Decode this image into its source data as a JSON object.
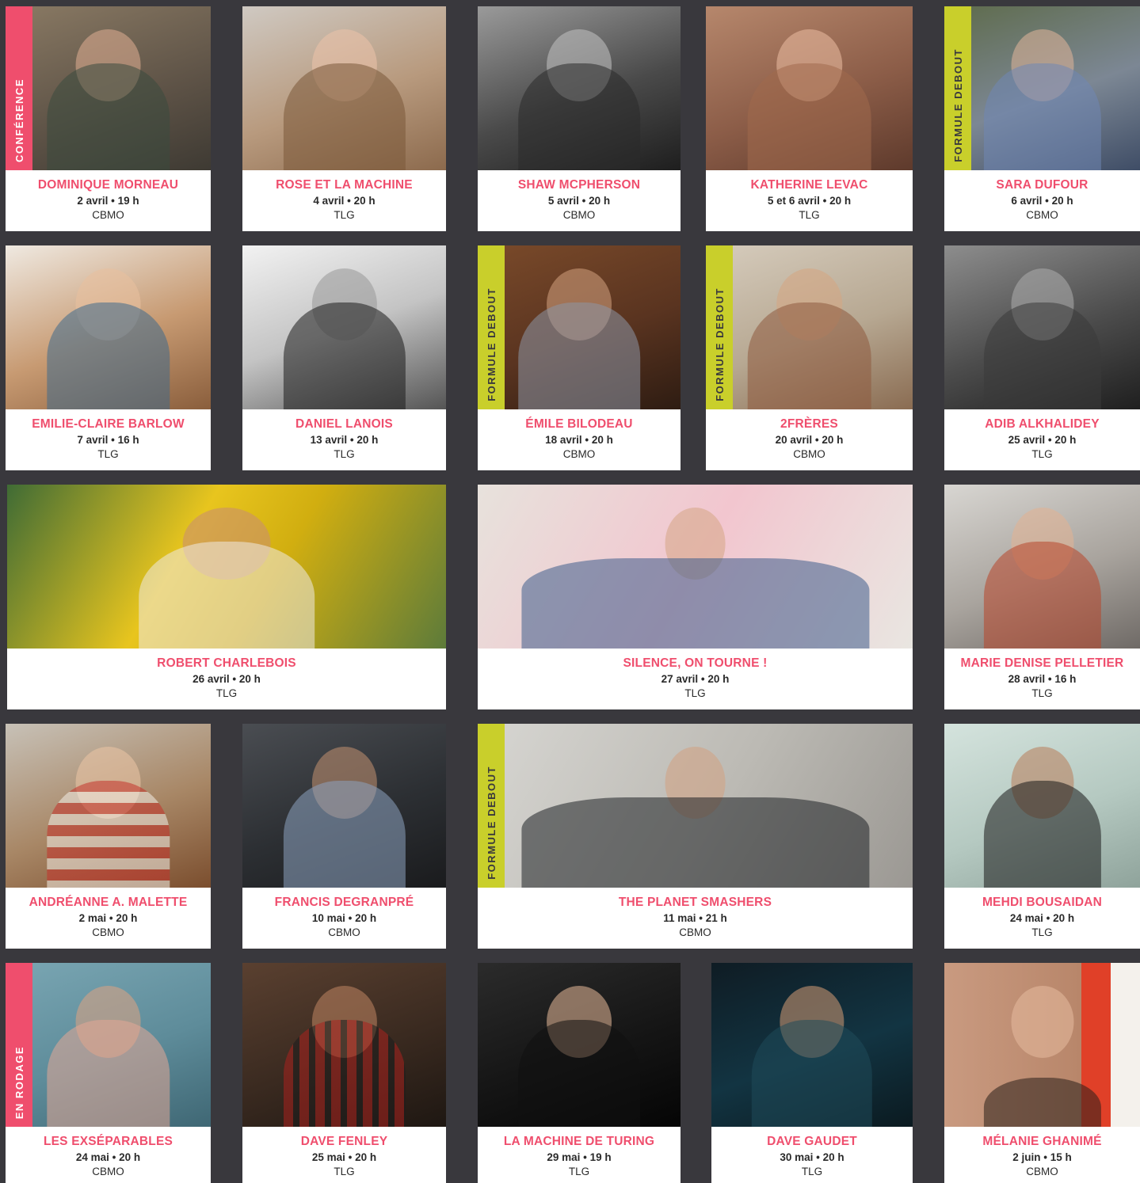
{
  "labels": {
    "conference": "CONFÉRENCE",
    "formule_debout": "FORMULE DEBOUT",
    "en_rodage": "EN RODAGE"
  },
  "events": [
    {
      "name": "DOMINIQUE MORNEAU",
      "date": "2 avril • 19 h",
      "venue": "CBMO"
    },
    {
      "name": "ROSE ET LA MACHINE",
      "date": "4 avril • 20 h",
      "venue": "TLG"
    },
    {
      "name": "SHAW MCPHERSON",
      "date": "5 avril • 20 h",
      "venue": "CBMO"
    },
    {
      "name": "KATHERINE LEVAC",
      "date": "5 et 6 avril • 20 h",
      "venue": "TLG"
    },
    {
      "name": "SARA DUFOUR",
      "date": "6 avril • 20 h",
      "venue": "CBMO"
    },
    {
      "name": "EMILIE-CLAIRE BARLOW",
      "date": "7 avril • 16 h",
      "venue": "TLG"
    },
    {
      "name": "DANIEL LANOIS",
      "date": "13 avril • 20 h",
      "venue": "TLG"
    },
    {
      "name": "ÉMILE BILODEAU",
      "date": "18 avril • 20 h",
      "venue": "CBMO"
    },
    {
      "name": "2FRÈRES",
      "date": "20 avril • 20 h",
      "venue": "CBMO"
    },
    {
      "name": "ADIB ALKHALIDEY",
      "date": "25 avril • 20 h",
      "venue": "TLG"
    },
    {
      "name": "ROBERT CHARLEBOIS",
      "date": "26 avril • 20 h",
      "venue": "TLG"
    },
    {
      "name": "SILENCE, ON TOURNE !",
      "date": "27 avril • 20 h",
      "venue": "TLG"
    },
    {
      "name": "MARIE DENISE PELLETIER",
      "date": "28 avril • 16 h",
      "venue": "TLG"
    },
    {
      "name": "ANDRÉANNE A. MALETTE",
      "date": "2 mai • 20 h",
      "venue": "CBMO"
    },
    {
      "name": "FRANCIS DEGRANPRÉ",
      "date": "10 mai • 20 h",
      "venue": "CBMO"
    },
    {
      "name": "THE PLANET SMASHERS",
      "date": "11 mai • 21 h",
      "venue": "CBMO"
    },
    {
      "name": "MEHDI BOUSAIDAN",
      "date": "24 mai • 20 h",
      "venue": "TLG"
    },
    {
      "name": "LES EXSÉPARABLES",
      "date": "24 mai • 20 h",
      "venue": "CBMO"
    },
    {
      "name": "DAVE FENLEY",
      "date": "25 mai • 20 h",
      "venue": "TLG"
    },
    {
      "name": "LA MACHINE DE TURING",
      "date": "29 mai • 19 h",
      "venue": "TLG"
    },
    {
      "name": "DAVE GAUDET",
      "date": "30 mai • 20 h",
      "venue": "TLG"
    },
    {
      "name": "MÉLANIE GHANIMÉ",
      "date": "2 juin • 15 h",
      "venue": "CBMO"
    }
  ]
}
